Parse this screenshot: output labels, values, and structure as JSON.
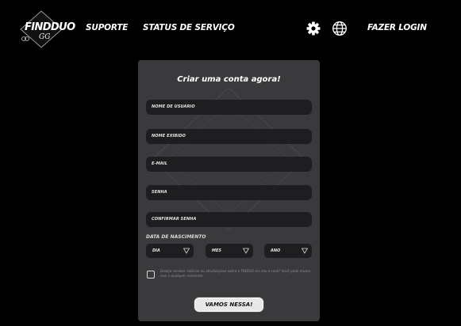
{
  "nav": {
    "logo_text": "FINDDUO",
    "logo_sub": "GG",
    "support": "SUPORTE",
    "status": "STATUS DE SERVIÇO",
    "login": "FAZER LOGIN",
    "icons": [
      "gear-icon",
      "globe-icon"
    ]
  },
  "form": {
    "title": "Criar uma conta agora!",
    "fields": {
      "username": "NOME DE USUARIO",
      "display_name": "NOME EXIBIDO",
      "email": "E-MAIL",
      "password": "SENHA",
      "confirm_password": "CONFIRMAR SENHA"
    },
    "dob_label": "DATA DE NASCIMENTO",
    "selects": {
      "day": "DIA",
      "month": "MES",
      "year": "ANO"
    },
    "consent_text": "Deseja receber notícias ou atualizações sobre o FINDUO em seu e-mail? Você pode mudar isso a qualquer momento",
    "submit": "VAMOS NESSA!"
  },
  "colors": {
    "background": "#000000",
    "card": "#3a3a3d",
    "field": "#1e1e21",
    "button": "#e8e8e8"
  }
}
